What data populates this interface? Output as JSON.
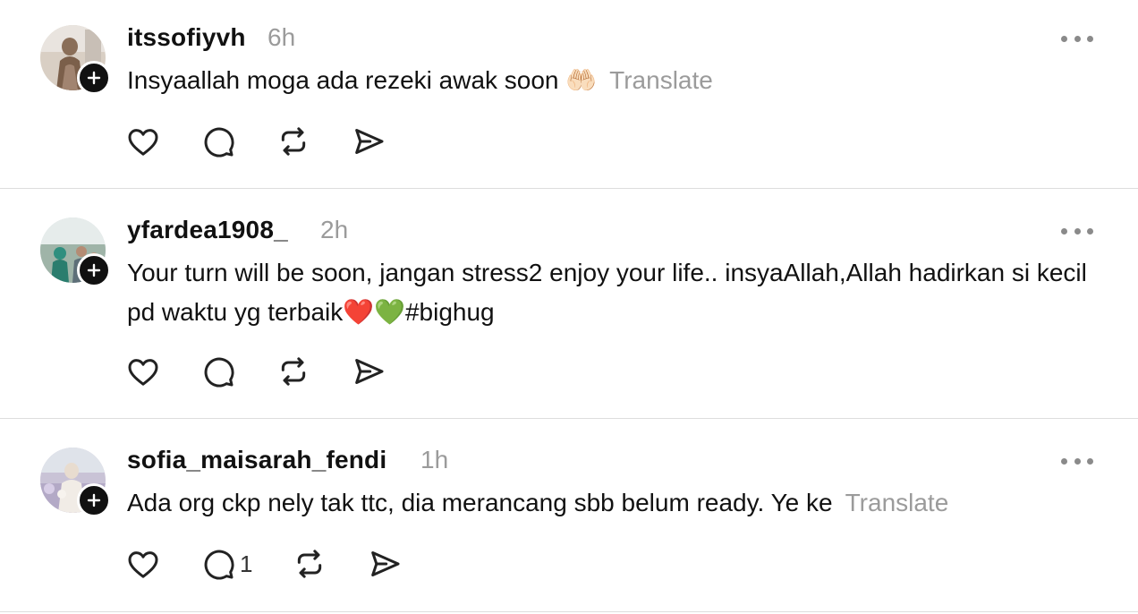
{
  "posts": [
    {
      "username": "itssofiyvh",
      "time": "6h",
      "text": "Insyaallah moga ada rezeki awak soon 🤲🏻",
      "translate_label": "Translate",
      "reply_count": ""
    },
    {
      "username": "yfardea1908_",
      "time": "2h",
      "text": "Your turn will be soon, jangan stress2 enjoy your life.. insyaAllah,Allah hadirkan si kecil pd waktu yg terbaik❤️💚#bighug",
      "translate_label": "",
      "reply_count": ""
    },
    {
      "username": "sofia_maisarah_fendi",
      "time": "1h",
      "text": "Ada org ckp nely tak ttc, dia merancang sbb belum ready. Ye ke",
      "translate_label": "Translate",
      "reply_count": "1"
    }
  ],
  "icons": {
    "like": "heart-icon",
    "reply": "comment-bubble-icon",
    "repost": "repost-icon",
    "share": "send-icon",
    "more": "more-options-icon",
    "follow": "plus-icon"
  },
  "colors": {
    "text": "#111111",
    "muted": "#9b9b9b",
    "divider": "#dddddd",
    "badge": "#111111"
  }
}
